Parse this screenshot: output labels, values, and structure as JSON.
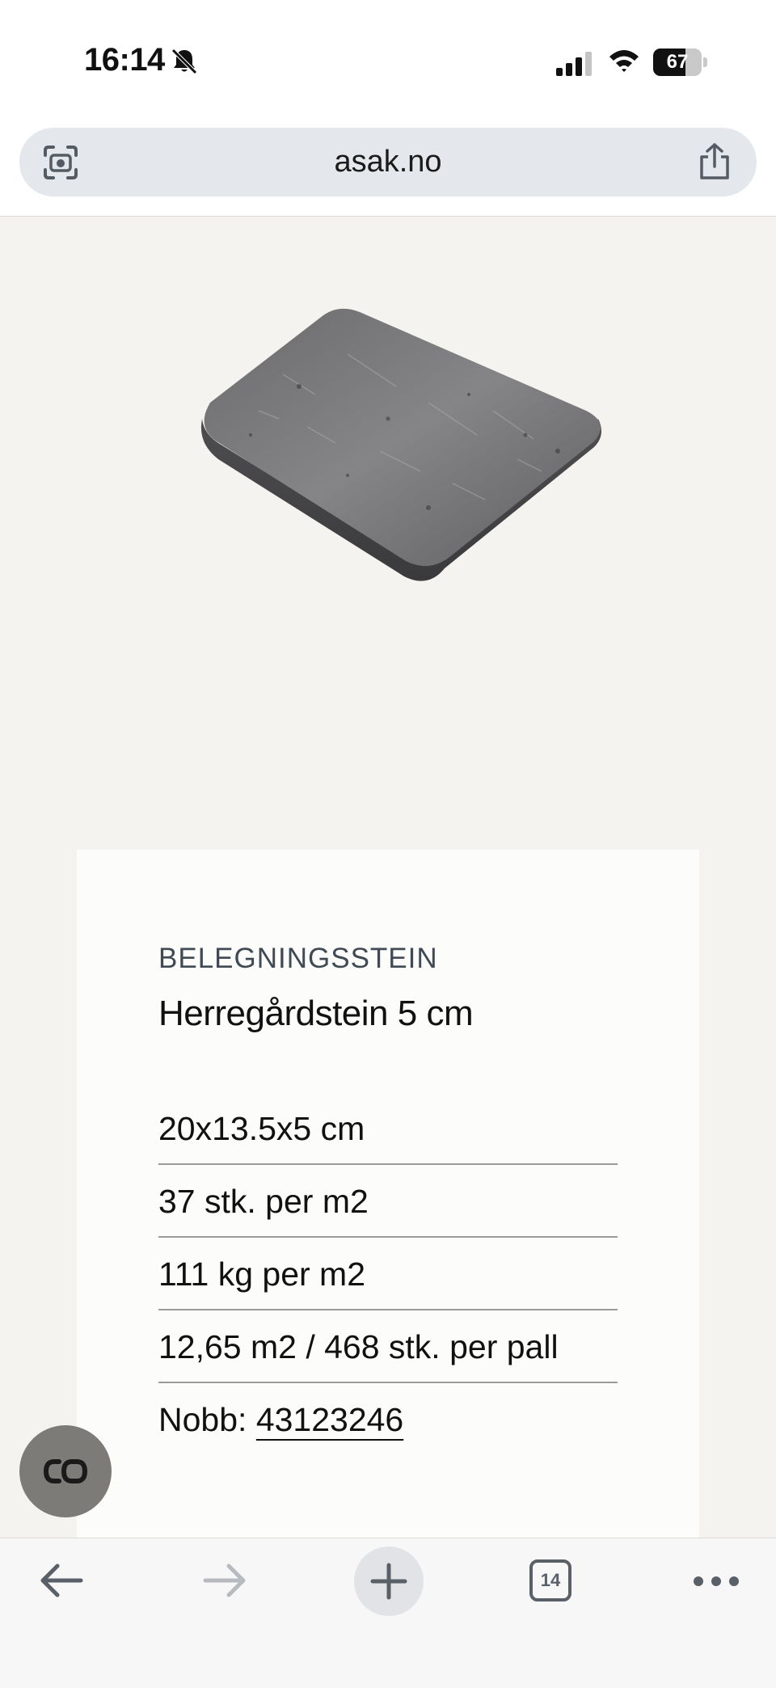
{
  "status_bar": {
    "time": "16:14",
    "battery_level": "67",
    "icons": [
      "bell-slash-icon",
      "signal-icon",
      "wifi-icon",
      "battery-icon"
    ]
  },
  "address_bar": {
    "url": "asak.no",
    "icons": [
      "lens-scan-icon",
      "share-icon"
    ]
  },
  "product": {
    "category": "BELEGNINGSSTEIN",
    "title": "Herregårdstein 5 cm",
    "specs": [
      "20x13.5x5 cm",
      "37 stk. per m2",
      "111 kg per m2",
      "12,65 m2 / 468 stk. per pall"
    ],
    "nobb_label": "Nobb: ",
    "nobb_number": "43123246"
  },
  "toolbar": {
    "items": [
      "back-arrow-icon",
      "forward-arrow-icon",
      "new-tab-plus-icon",
      "tabs-icon",
      "more-icon"
    ],
    "tab_count": "14"
  },
  "colors": {
    "page_background": "#f4f3ef",
    "card_background": "#fcfcfb",
    "address_bar": "#e4e8ec",
    "category_text": "#3f4a55",
    "fab": "#7d7b78"
  }
}
